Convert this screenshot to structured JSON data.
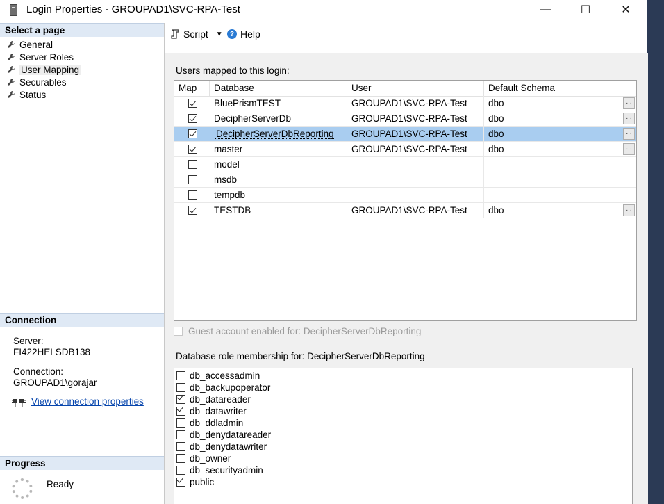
{
  "window": {
    "title": "Login Properties - GROUPAD1\\SVC-RPA-Test",
    "minimize": "—",
    "maximize": "☐",
    "close": "✕"
  },
  "select_page": {
    "header": "Select a page",
    "items": [
      {
        "label": "General"
      },
      {
        "label": "Server Roles"
      },
      {
        "label": "User Mapping"
      },
      {
        "label": "Securables"
      },
      {
        "label": "Status"
      }
    ]
  },
  "connection": {
    "header": "Connection",
    "server_label": "Server:",
    "server_value": "FI422HELSDB138",
    "connection_label": "Connection:",
    "connection_value": "GROUPAD1\\gorajar",
    "view_link": "View connection properties"
  },
  "progress": {
    "header": "Progress",
    "status": "Ready"
  },
  "toolbar": {
    "script_label": "Script",
    "help_label": "Help"
  },
  "mapping": {
    "label": "Users mapped to this login:",
    "columns": [
      "Map",
      "Database",
      "User",
      "Default Schema"
    ],
    "rows": [
      {
        "map": true,
        "database": "BluePrismTEST",
        "user": "GROUPAD1\\SVC-RPA-Test",
        "schema": "dbo"
      },
      {
        "map": true,
        "database": "DecipherServerDb",
        "user": "GROUPAD1\\SVC-RPA-Test",
        "schema": "dbo"
      },
      {
        "map": true,
        "database": "DecipherServerDbReporting",
        "user": "GROUPAD1\\SVC-RPA-Test",
        "schema": "dbo"
      },
      {
        "map": true,
        "database": "master",
        "user": "GROUPAD1\\SVC-RPA-Test",
        "schema": "dbo"
      },
      {
        "map": false,
        "database": "model",
        "user": "",
        "schema": ""
      },
      {
        "map": false,
        "database": "msdb",
        "user": "",
        "schema": ""
      },
      {
        "map": false,
        "database": "tempdb",
        "user": "",
        "schema": ""
      },
      {
        "map": true,
        "database": "TESTDB",
        "user": "GROUPAD1\\SVC-RPA-Test",
        "schema": "dbo"
      }
    ],
    "ellipsis": "..."
  },
  "guest": {
    "label": "Guest account enabled for: DecipherServerDbReporting"
  },
  "roles": {
    "label": "Database role membership for: DecipherServerDbReporting",
    "items": [
      {
        "name": "db_accessadmin",
        "checked": false
      },
      {
        "name": "db_backupoperator",
        "checked": false
      },
      {
        "name": "db_datareader",
        "checked": true
      },
      {
        "name": "db_datawriter",
        "checked": true
      },
      {
        "name": "db_ddladmin",
        "checked": false
      },
      {
        "name": "db_denydatareader",
        "checked": false
      },
      {
        "name": "db_denydatawriter",
        "checked": false
      },
      {
        "name": "db_owner",
        "checked": false
      },
      {
        "name": "db_securityadmin",
        "checked": false
      },
      {
        "name": "public",
        "checked": true
      }
    ]
  },
  "colors": {
    "selected_row": "#a9cdf0",
    "pane_header": "#dfe9f5",
    "link": "#0645ad"
  }
}
